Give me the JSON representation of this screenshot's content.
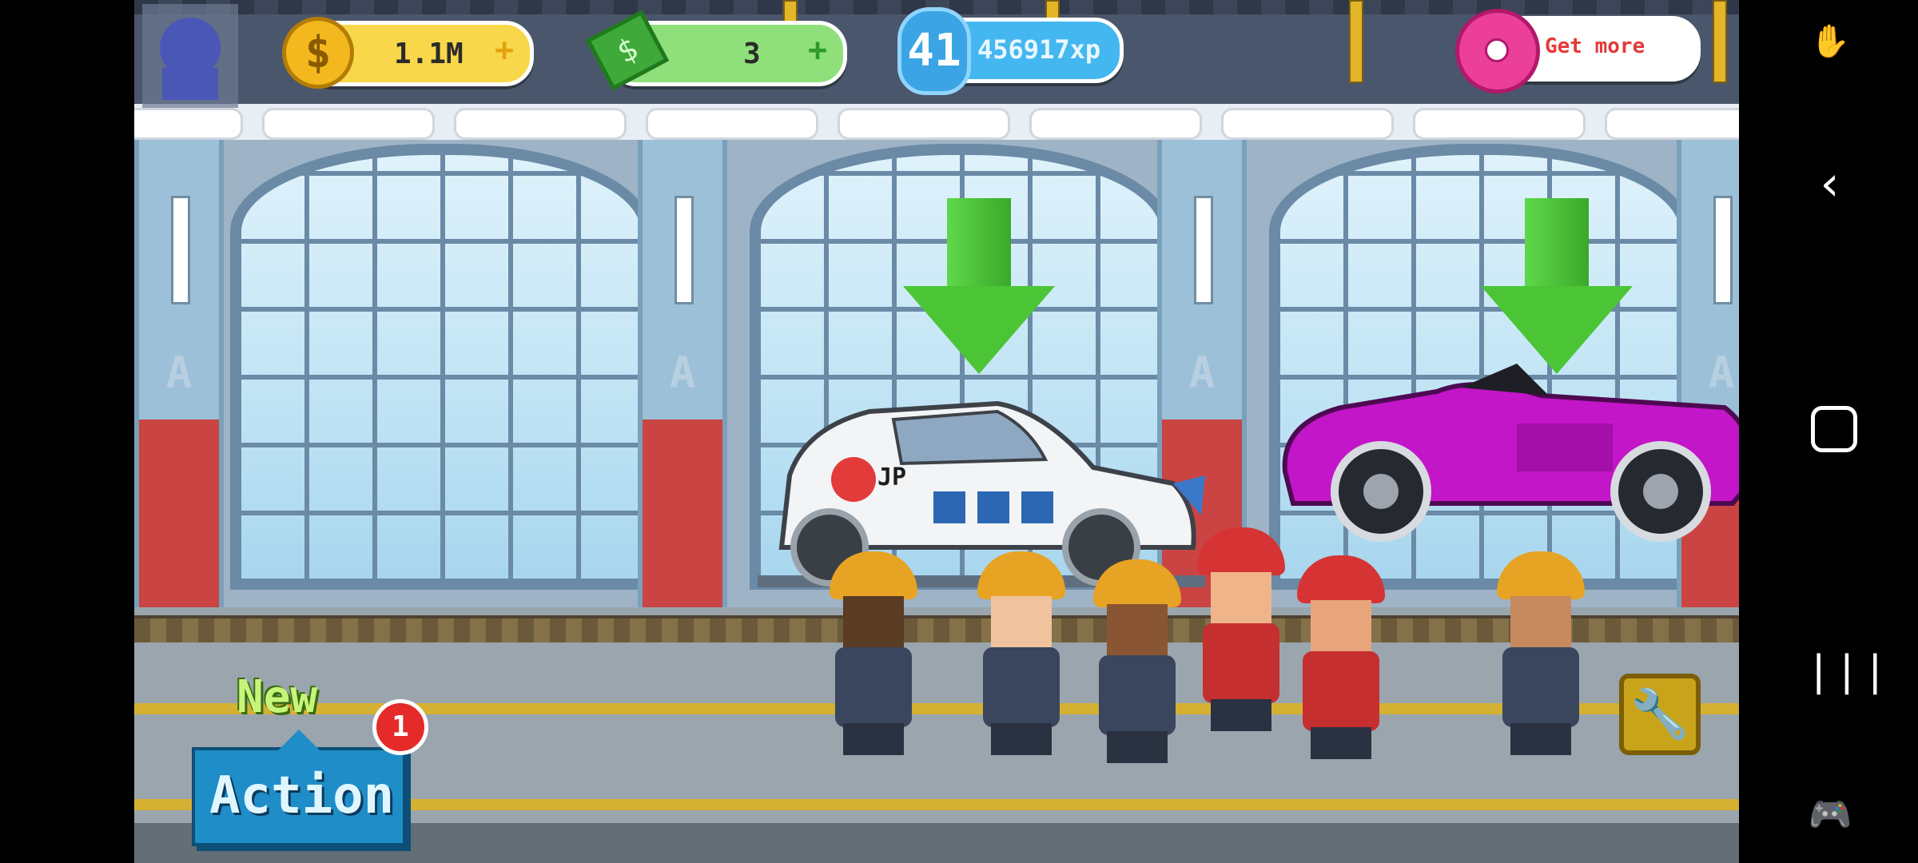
{
  "hud": {
    "coins": "1.1M",
    "cash": "3",
    "level": "41",
    "xp": "456917xp",
    "get_more": "Get more",
    "plus": "+"
  },
  "actions": {
    "new_label": "New",
    "action_label": "Action",
    "notification_count": "1"
  },
  "colors": {
    "helmet_gold": "#e7a323",
    "helmet_red": "#d63434",
    "suit_navy": "#39465e",
    "suit_red": "#c62f2f",
    "pink_car": "#c316c8"
  },
  "icons": {
    "coin": "$",
    "wrench": "🔧",
    "back": "‹",
    "recents": "|||"
  }
}
